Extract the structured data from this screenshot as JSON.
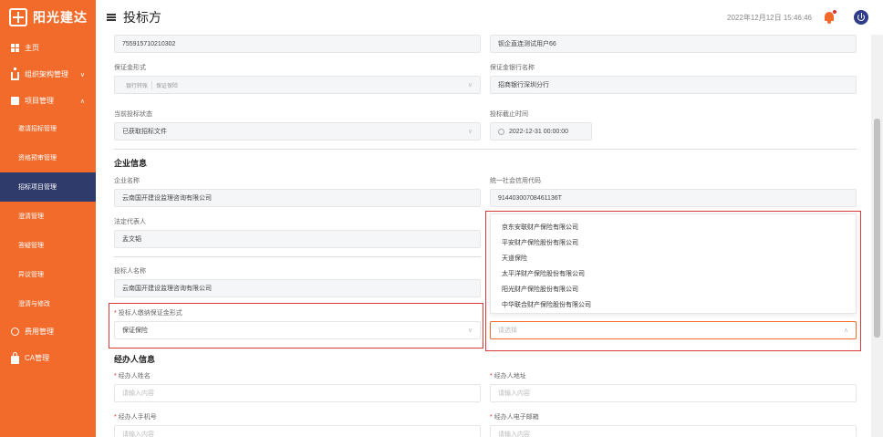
{
  "brand": {
    "name": "阳光建达"
  },
  "sidebar": {
    "items": [
      {
        "label": "主页",
        "icon": "grid-icon"
      },
      {
        "label": "组织架构管理",
        "icon": "org-icon"
      },
      {
        "label": "项目管理",
        "icon": "folder-icon"
      }
    ],
    "sub_items": [
      {
        "label": "邀请招标管理"
      },
      {
        "label": "资格预审管理"
      },
      {
        "label": "招标项目管理"
      },
      {
        "label": "澄清管理"
      },
      {
        "label": "答疑管理"
      },
      {
        "label": "异议管理"
      },
      {
        "label": "澄清与修改"
      }
    ],
    "bottom_items": [
      {
        "label": "费用管理",
        "icon": "fee-icon"
      },
      {
        "label": "CA管理",
        "icon": "lock-icon"
      }
    ],
    "active_sub_item": "招标项目管理"
  },
  "header": {
    "title": "投标方",
    "datetime": "2022年12月12日 15:46:46"
  },
  "form": {
    "row0": {
      "left_value": "755915710210302",
      "right_value": "钡企直连测试用户66"
    },
    "guarantee_form": {
      "label": "保证金形式",
      "tags": [
        "银行转账",
        "保证保险"
      ]
    },
    "guarantee_bank": {
      "label": "保证金银行名称",
      "value": "招商银行深圳分行"
    },
    "bid_status": {
      "label": "当前投标状态",
      "value": "已获取招标文件"
    },
    "bid_deadline": {
      "label": "投标截止时间",
      "value": "2022-12-31 00:00:00"
    },
    "company_section": {
      "title": "企业信息"
    },
    "company_name": {
      "label": "企业名称",
      "value": "云南国开建设监理咨询有限公司"
    },
    "credit_code": {
      "label": "统一社会信用代码",
      "value": "91440300708461136T"
    },
    "legal_rep": {
      "label": "法定代表人",
      "value": "孟文韬"
    },
    "bidder_name": {
      "label": "投标人名称",
      "value": "云南国开建设监理咨询有限公司"
    },
    "payment_form": {
      "label": "投标人缴纳保证金形式",
      "value": "保证保险"
    },
    "insurer_select": {
      "placeholder": "请选择"
    },
    "insurer_options": [
      "京东安联财产保险有限公司",
      "平安财产保险股份有限公司",
      "天道保险",
      "太平洋财产保险股份有限公司",
      "阳光财产保险股份有限公司",
      "中华联合财产保险股份有限公司"
    ],
    "agent_section": {
      "title": "经办人信息"
    },
    "agent_name": {
      "label": "经办人姓名",
      "placeholder": "请输入内容"
    },
    "agent_address": {
      "label": "经办人地址",
      "placeholder": "请输入内容"
    },
    "agent_phone": {
      "label": "经办人手机号",
      "placeholder": "请输入内容"
    },
    "agent_email": {
      "label": "经办人电子邮箱",
      "placeholder": "请输入内容"
    }
  },
  "colors": {
    "brand": "#f26b2b",
    "active_nav": "#2f3b6b",
    "highlight": "#d93a3a"
  }
}
